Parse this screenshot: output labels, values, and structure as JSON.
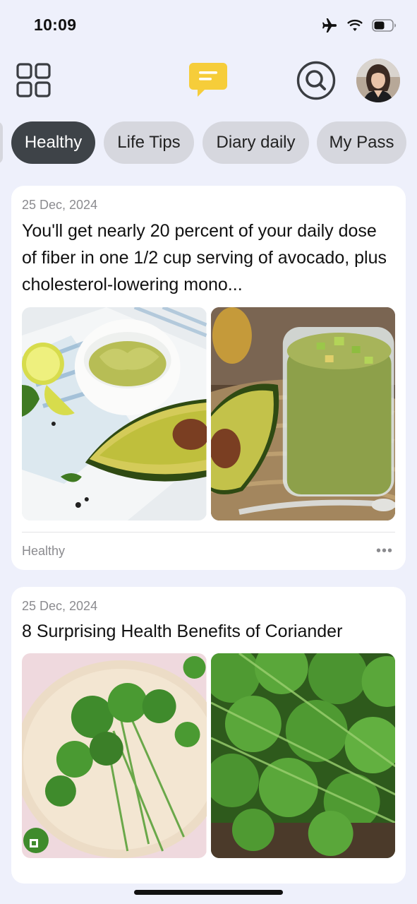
{
  "status_bar": {
    "time": "10:09",
    "icons": [
      "airplane-icon",
      "wifi-icon",
      "battery-icon"
    ]
  },
  "header": {
    "icons": [
      "grid-icon",
      "chat-icon",
      "search-icon",
      "avatar"
    ],
    "accent_color": "#f6cd3a"
  },
  "tabs": [
    {
      "label": "Healthy",
      "active": true
    },
    {
      "label": "Life Tips",
      "active": false
    },
    {
      "label": "Diary daily",
      "active": false
    },
    {
      "label": "My Pass",
      "active": false
    }
  ],
  "posts": [
    {
      "date": "25 Dec, 2024",
      "title": "You'll get nearly 20 percent of your daily dose of fiber in one 1/2 cup serving of avocado, plus cholesterol-lowering mono...",
      "tag": "Healthy",
      "more": "•••",
      "images": [
        "avocado-dip-image",
        "avocado-smoothie-image"
      ]
    },
    {
      "date": "25 Dec, 2024",
      "title": "8 Surprising Health Benefits of Coriander",
      "images": [
        "coriander-plate-image",
        "coriander-closeup-image"
      ]
    }
  ]
}
